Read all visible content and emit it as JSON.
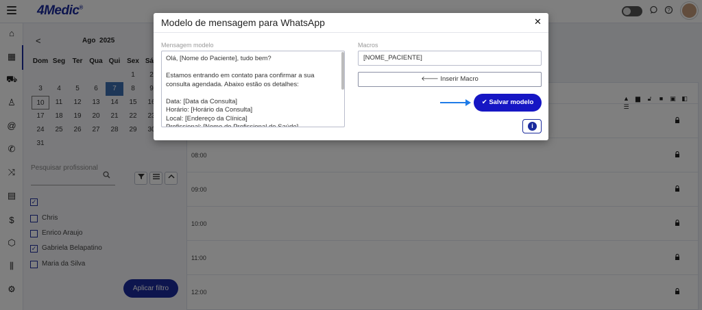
{
  "app": {
    "logo": "4Medic",
    "logo_mark": "®"
  },
  "topbar": {
    "chat_icon": "chat-icon",
    "help_icon": "help-icon"
  },
  "rail": {
    "icons": [
      "home-icon",
      "calendar-icon",
      "car-icon",
      "user-icon",
      "at-icon",
      "phone-icon",
      "shuffle-icon",
      "clipboard-icon",
      "dollar-icon",
      "package-icon",
      "chart-icon",
      "settings-icon"
    ]
  },
  "calendar": {
    "prev_label": "<",
    "month": "Ago",
    "year": "2025",
    "weekdays": [
      "Dom",
      "Seg",
      "Ter",
      "Qua",
      "Qui",
      "Sex",
      "Sáb"
    ],
    "weeks": [
      [
        "",
        "",
        "",
        "",
        "",
        "1",
        "2"
      ],
      [
        "3",
        "4",
        "5",
        "6",
        "7",
        "8",
        "9"
      ],
      [
        "10",
        "11",
        "12",
        "13",
        "14",
        "15",
        "16"
      ],
      [
        "17",
        "18",
        "19",
        "20",
        "21",
        "22",
        "23"
      ],
      [
        "24",
        "25",
        "26",
        "27",
        "28",
        "29",
        "30"
      ],
      [
        "31",
        "",
        "",
        "",
        "",
        "",
        ""
      ]
    ],
    "selected_day": "7",
    "today_day": "10"
  },
  "filter": {
    "search_placeholder": "Pesquisar profissional",
    "professionals": [
      {
        "name": "",
        "checked": true
      },
      {
        "name": "Chris",
        "checked": false
      },
      {
        "name": "Enrico Araujo",
        "checked": false
      },
      {
        "name": "Gabriela Belapatino",
        "checked": true
      },
      {
        "name": "Maria da Silva",
        "checked": false
      }
    ],
    "apply_label": "Aplicar filtro"
  },
  "schedule": {
    "slots": [
      "",
      "08:00",
      "09:00",
      "10:00",
      "11:00",
      "12:00"
    ]
  },
  "modal": {
    "title": "Modelo de mensagem para WhatsApp",
    "close_label": "✕",
    "message_label": "Mensagem modelo",
    "message_text": "Olá, [Nome do Paciente], tudo bem?\n\nEstamos entrando em contato para confirmar a sua consulta agendada. Abaixo estão os detalhes:\n\nData: [Data da Consulta]\nHorário: [Horário da Consulta]\nLocal: [Endereço da Clínica]\nProfissional: [Nome do Profissional de Saúde]",
    "macros_label": "Macros",
    "macro_selected": "[NOME_PACIENTE]",
    "insert_label": "Inserir Macro",
    "save_label": "Salvar modelo",
    "accent_color": "#1616c4",
    "arrow_color": "#1e7be8"
  }
}
